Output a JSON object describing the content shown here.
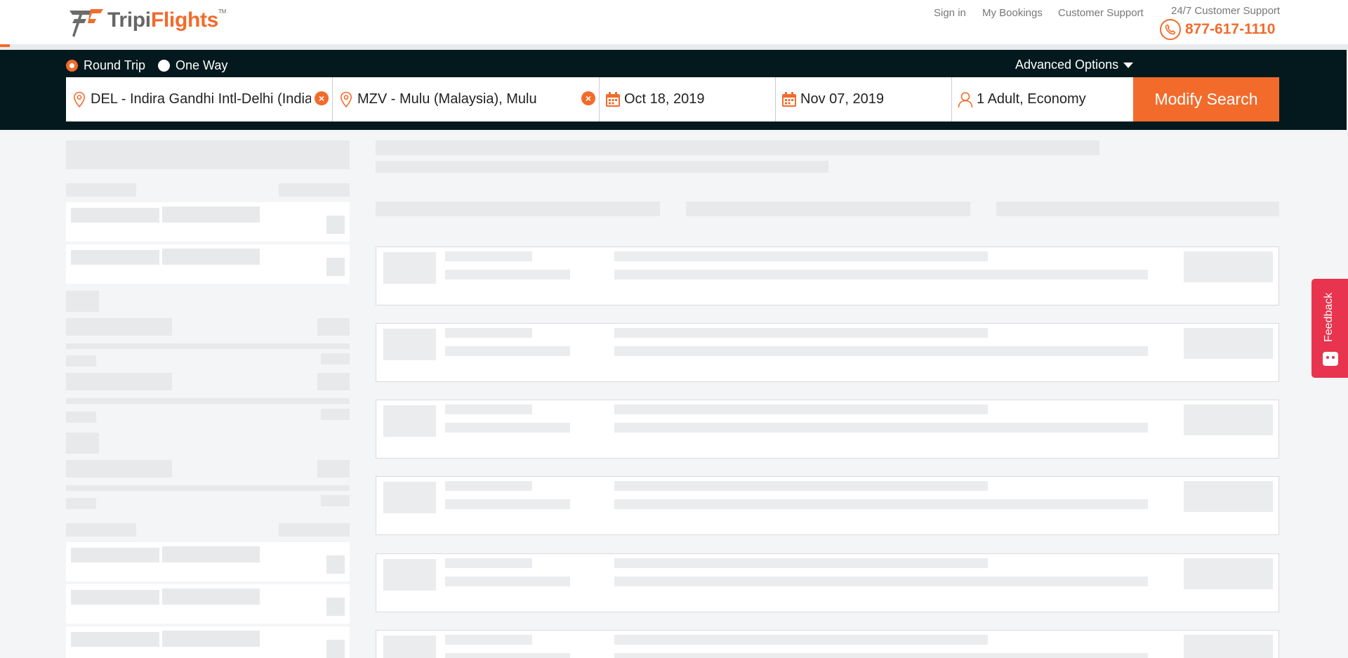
{
  "brand": {
    "name_part1": "Tripi",
    "name_part2": "Flights",
    "tm": "TM"
  },
  "header": {
    "links": [
      "Sign in",
      "My Bookings",
      "Customer Support"
    ],
    "support_label": "24/7 Customer Support",
    "phone": "877-617-1110"
  },
  "search": {
    "trip_types": [
      {
        "label": "Round Trip",
        "selected": true
      },
      {
        "label": "One Way",
        "selected": false
      }
    ],
    "advanced_options": "Advanced Options",
    "from": "DEL - Indira Gandhi Intl-Delhi (India)",
    "to": "MZV - Mulu (Malaysia), Mulu",
    "depart_date": "Oct 18, 2019",
    "return_date": "Nov 07, 2019",
    "travelers": "1 Adult, Economy",
    "submit": "Modify Search"
  },
  "feedback": {
    "label": "Feedback"
  },
  "colors": {
    "accent": "#f26b2b",
    "bar": "#04191d",
    "feedback": "#e8344e"
  }
}
